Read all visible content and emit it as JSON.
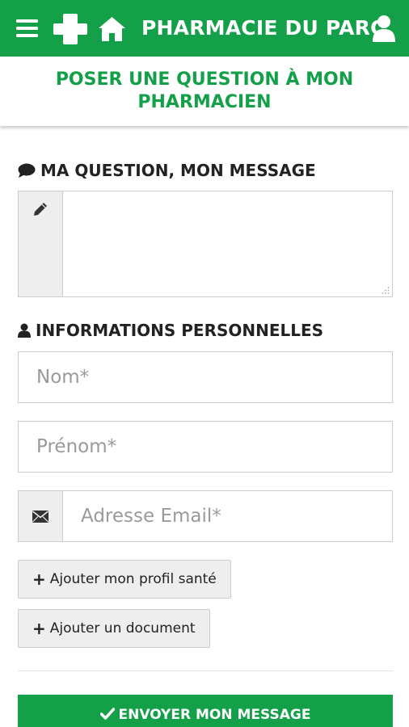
{
  "header": {
    "brand": "PHARMACIE DU PARC",
    "icons": [
      "menu-icon",
      "pharmacy-cross-icon",
      "home-icon",
      "user-icon"
    ]
  },
  "page": {
    "title": "POSER UNE QUESTION À MON PHARMACIEN"
  },
  "question_section": {
    "heading": "MA QUESTION, MON MESSAGE",
    "icon": "speech-bubble-icon",
    "field_icon": "pencil-icon",
    "message_value": ""
  },
  "personal_section": {
    "heading": "INFORMATIONS PERSONNELLES",
    "icon": "user-icon",
    "nom_placeholder": "Nom*",
    "prenom_placeholder": "Prénom*",
    "email_placeholder": "Adresse Email*",
    "email_icon": "envelope-icon"
  },
  "buttons": {
    "add_profile": "Ajouter mon profil santé",
    "add_document": "Ajouter un document",
    "submit": "ENVOYER MON MESSAGE"
  },
  "colors": {
    "brand_green": "#13a049",
    "addon_gray": "#eeeeee",
    "border_gray": "#cccccc"
  }
}
